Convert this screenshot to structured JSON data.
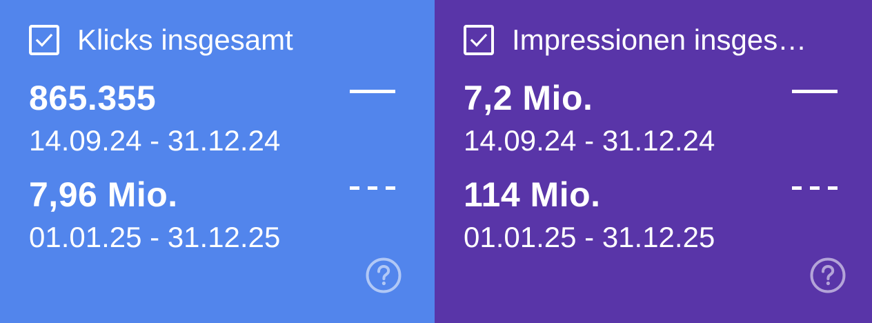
{
  "cards": [
    {
      "title": "Klicks insgesamt",
      "checked": true,
      "color": "#5285EC",
      "current_value": "865.355",
      "current_range": "14.09.24 - 31.12.24",
      "previous_value": "7,96 Mio.",
      "previous_range": "01.01.25 - 31.12.25",
      "icons": {
        "checkbox": "checkbox-checked-icon",
        "current_line": "solid-line-icon",
        "previous_line": "dashed-line-icon",
        "help": "help-circle-icon"
      }
    },
    {
      "title": "Impressionen insges…",
      "checked": true,
      "color": "#5935A8",
      "current_value": "7,2 Mio.",
      "current_range": "14.09.24 - 31.12.24",
      "previous_value": "114 Mio.",
      "previous_range": "01.01.25 - 31.12.25",
      "icons": {
        "checkbox": "checkbox-checked-icon",
        "current_line": "solid-line-icon",
        "previous_line": "dashed-line-icon",
        "help": "help-circle-icon"
      }
    }
  ]
}
